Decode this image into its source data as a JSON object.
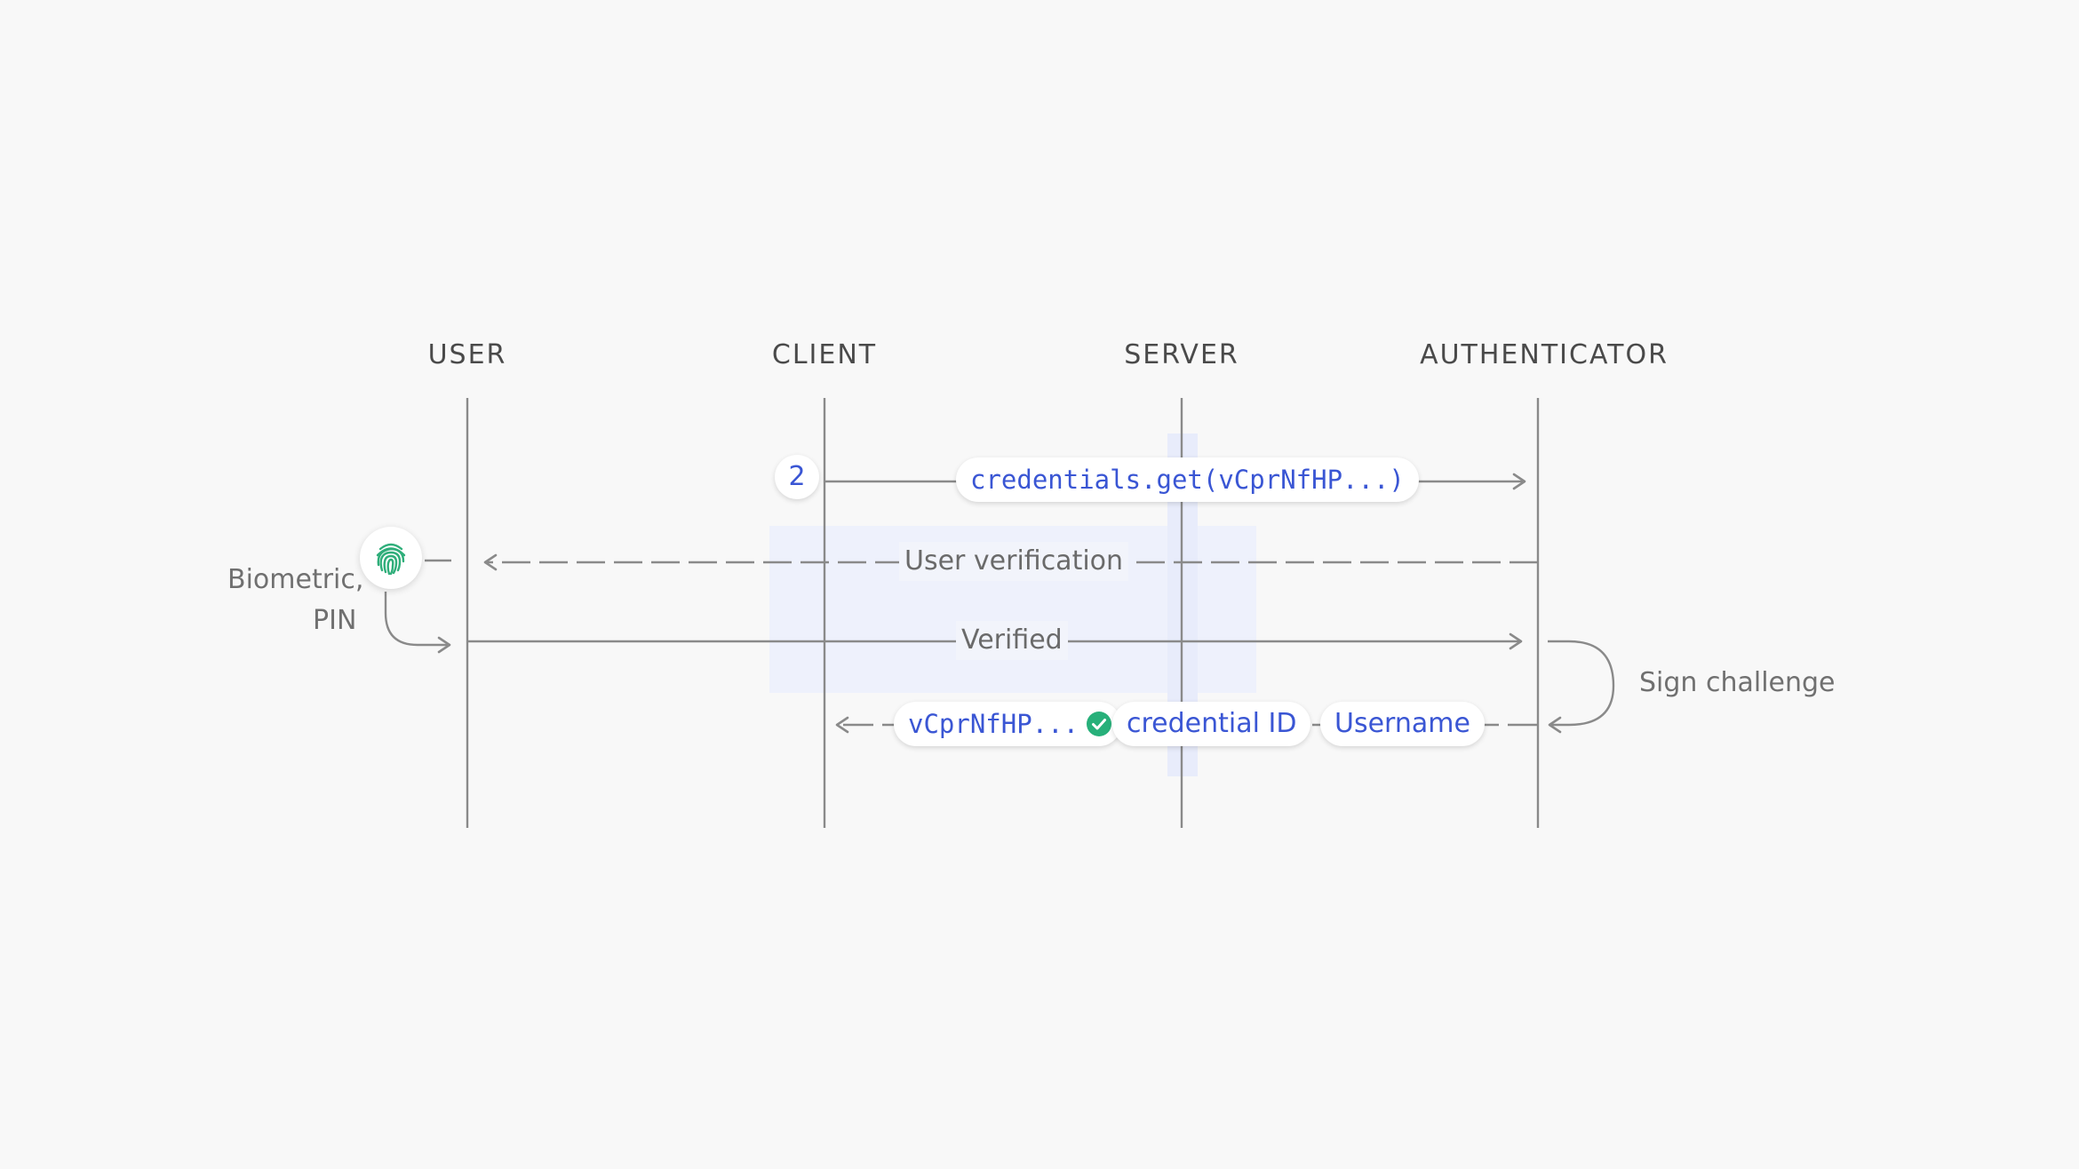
{
  "actors": {
    "user": "USER",
    "client": "CLIENT",
    "server": "SERVER",
    "authenticator": "AUTHENTICATOR"
  },
  "step_number": "2",
  "messages": {
    "credentials_call": "credentials.get(vCprNfHP...)",
    "user_verification": "User verification",
    "verified": "Verified",
    "challenge": "vCprNfHP...",
    "credential_id": "credential ID",
    "username": "Username"
  },
  "side_labels": {
    "biometric_line1": "Biometric,",
    "biometric_line2": "PIN",
    "sign_challenge": "Sign challenge"
  },
  "icons": {
    "fingerprint": "fingerprint-icon",
    "check": "check-circle-icon"
  },
  "colors": {
    "background": "#f8f8f8",
    "accent_blue": "#3a56d4",
    "highlight_area": "#eef1fc",
    "line_gray": "#8a8a8a",
    "fingerprint_green": "#2fae7a",
    "check_green": "#27b07a"
  }
}
